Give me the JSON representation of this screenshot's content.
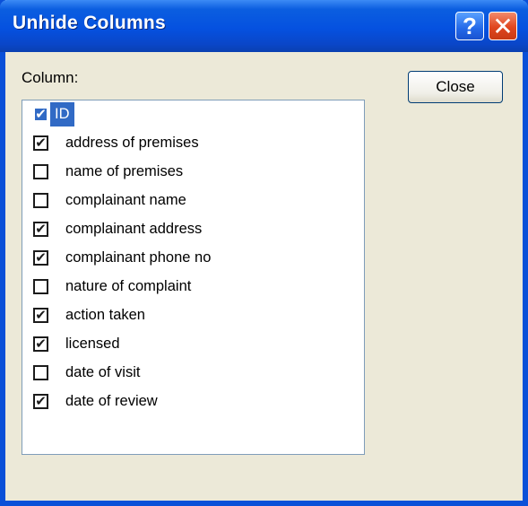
{
  "dialog": {
    "title": "Unhide Columns",
    "help_glyph": "?",
    "close_glyph": "✕",
    "column_label": "Column:",
    "close_button_label": "Close",
    "accent_color": "#0551e0",
    "selection_color": "#316ac5"
  },
  "columns": [
    {
      "label": "ID",
      "checked": true,
      "selected": true
    },
    {
      "label": "address of premises",
      "checked": true,
      "selected": false
    },
    {
      "label": "name of premises",
      "checked": false,
      "selected": false
    },
    {
      "label": "complainant name",
      "checked": false,
      "selected": false
    },
    {
      "label": "complainant address",
      "checked": true,
      "selected": false
    },
    {
      "label": "complainant phone no",
      "checked": true,
      "selected": false
    },
    {
      "label": "nature of complaint",
      "checked": false,
      "selected": false
    },
    {
      "label": "action taken",
      "checked": true,
      "selected": false
    },
    {
      "label": "licensed",
      "checked": true,
      "selected": false
    },
    {
      "label": "date of visit",
      "checked": false,
      "selected": false
    },
    {
      "label": "date of review",
      "checked": true,
      "selected": false
    }
  ]
}
